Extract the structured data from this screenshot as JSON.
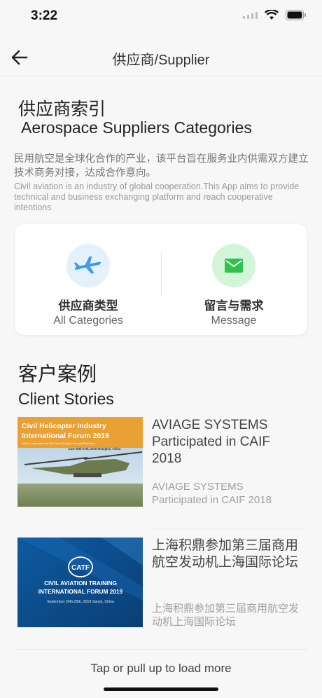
{
  "status": {
    "time": "3:22"
  },
  "nav": {
    "title": "供应商/Supplier"
  },
  "index": {
    "title_zh": "供应商索引",
    "title_en": "Aerospace Suppliers Categories",
    "intro_zh": "民用航空是全球化合作的产业，该平台旨在服务业内供需双方建立技术商务对接，达成合作意向。",
    "intro_en": "Civil aviation is an industry of global cooperation.This App aims to provide technical and business exchanging platform and reach cooperative intentions"
  },
  "card": {
    "categories": {
      "zh": "供应商类型",
      "en": "All Categories",
      "icon": "airplane-icon"
    },
    "message": {
      "zh": "留言与需求",
      "en": "Message",
      "icon": "envelope-icon"
    }
  },
  "stories": {
    "title_zh": "客户案例",
    "title_en": "Client Stories",
    "items": [
      {
        "title": "AVIAGE SYSTEMS Participated in CAIF 2018",
        "subtitle": "AVIAGE SYSTEMS Participated in CAIF 2018",
        "banner_line1": "Civil Helicopter Industry",
        "banner_line2": "International Forum 2019",
        "banner_small": "Held in conjunction with 10th China (Tianjin) Helicopter Exposition",
        "banner_date": "June 25th-27th, 2019   Shanghai, China"
      },
      {
        "title": "上海积鼎参加第三届商用航空发动机上海国际论坛",
        "subtitle": "上海积鼎参加第三届商用航空发动机上海国际论坛",
        "banner_logo": "CATF",
        "banner_line1": "CIVIL AVIATION TRAINING",
        "banner_line2": "INTERNATIONAL FORUM 2019",
        "banner_date": "September 24th-25th, 2019   Sanya, China"
      }
    ]
  },
  "footer": {
    "load_more": "Tap or pull up to load more"
  },
  "colors": {
    "accent_blue": "#3d9ae8",
    "accent_green": "#31c24d",
    "banner_orange": "#e9a134",
    "banner_navy": "#0d4f8d"
  }
}
